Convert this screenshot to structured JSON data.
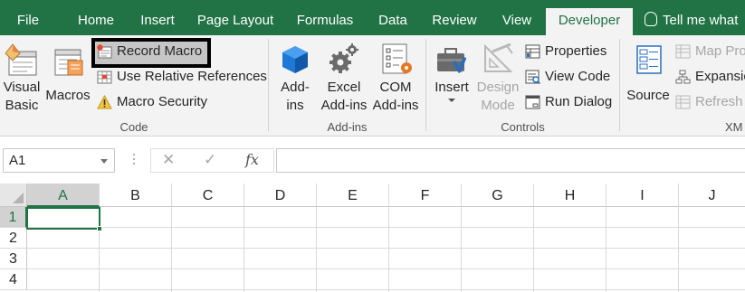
{
  "tabs": [
    {
      "label": "File"
    },
    {
      "label": "Home"
    },
    {
      "label": "Insert"
    },
    {
      "label": "Page Layout"
    },
    {
      "label": "Formulas"
    },
    {
      "label": "Data"
    },
    {
      "label": "Review"
    },
    {
      "label": "View"
    },
    {
      "label": "Developer"
    }
  ],
  "active_tab": "Developer",
  "tell_me": "Tell me what",
  "colors": {
    "accent": "#217346",
    "ribbon_bg": "#f3f3f3",
    "record_dot": "#e8432e"
  },
  "ribbon": {
    "code": {
      "label": "Code",
      "visual_basic": {
        "line1": "Visual",
        "line2": "Basic",
        "icon": "visual-basic-icon"
      },
      "macros": {
        "label": "Macros",
        "icon": "macros-icon"
      },
      "record_macro": {
        "label": "Record Macro",
        "icon": "record-macro-icon"
      },
      "relative_refs": {
        "label": "Use Relative References",
        "icon": "relative-references-icon"
      },
      "macro_security": {
        "label": "Macro Security",
        "icon": "warning-icon"
      }
    },
    "addins": {
      "label": "Add-ins",
      "addins": {
        "line1": "Add-",
        "line2": "ins",
        "icon": "office-addins-icon"
      },
      "excel_addins": {
        "line1": "Excel",
        "line2": "Add-ins",
        "icon": "gear-icon"
      },
      "com_addins": {
        "line1": "COM",
        "line2": "Add-ins",
        "icon": "com-addins-icon"
      }
    },
    "controls": {
      "label": "Controls",
      "insert": {
        "label": "Insert",
        "icon": "toolbox-icon"
      },
      "design_mode": {
        "line1": "Design",
        "line2": "Mode",
        "icon": "design-mode-icon"
      },
      "properties": {
        "label": "Properties",
        "icon": "properties-icon"
      },
      "view_code": {
        "label": "View Code",
        "icon": "view-code-icon"
      },
      "run_dialog": {
        "label": "Run Dialog",
        "icon": "run-dialog-icon"
      }
    },
    "xml": {
      "label": "XM",
      "source": {
        "label": "Source",
        "icon": "xml-source-icon"
      },
      "map_properties": {
        "label": "Map Pro"
      },
      "expansion_packs": {
        "label": "Expansio"
      },
      "refresh_data": {
        "label": "Refresh I"
      }
    }
  },
  "formula_bar": {
    "name_box": "A1",
    "cancel_glyph": "✕",
    "enter_glyph": "✓",
    "fx_glyph": "fx",
    "formula": ""
  },
  "sheet": {
    "columns": [
      "A",
      "B",
      "C",
      "D",
      "E",
      "F",
      "G",
      "H",
      "I",
      "J"
    ],
    "rows": [
      "1",
      "2",
      "3",
      "4"
    ],
    "selected_cell": "A1"
  }
}
